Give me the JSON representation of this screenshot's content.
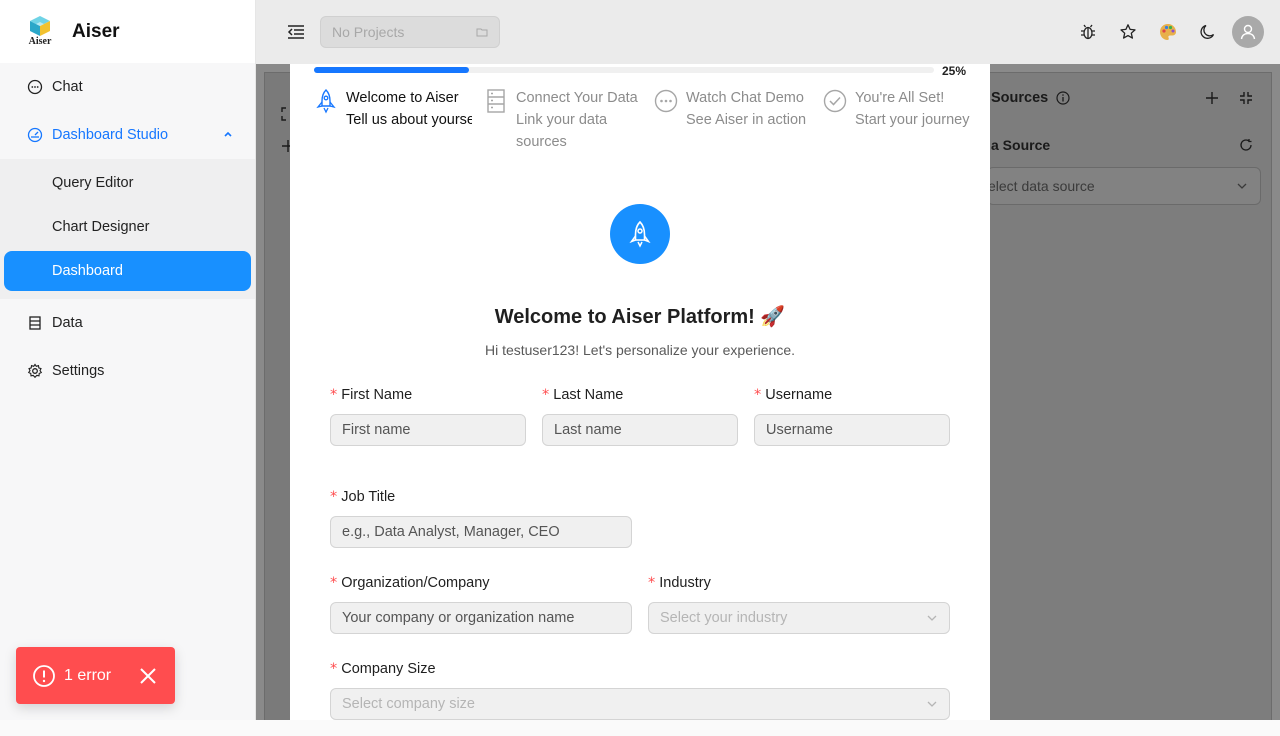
{
  "app": {
    "name": "Aiser",
    "logo_text": "Aiser"
  },
  "sidebar": {
    "items": [
      {
        "label": "Chat"
      },
      {
        "label": "Dashboard Studio"
      },
      {
        "label": "Data"
      },
      {
        "label": "Settings"
      }
    ],
    "sub_items": [
      {
        "label": "Query Editor"
      },
      {
        "label": "Chart Designer"
      },
      {
        "label": "Dashboard"
      }
    ]
  },
  "header": {
    "project_placeholder": "No Projects"
  },
  "workspace": {
    "sources_title": "Sources",
    "data_source_label": "a Source",
    "data_source_placeholder": "elect data source"
  },
  "onboarding": {
    "progress_percent": 25,
    "progress_label": "25%",
    "steps": [
      {
        "title": "Welcome to Aiser",
        "desc": "Tell us about yourself",
        "state": "current"
      },
      {
        "title": "Connect Your Data",
        "desc": "Link your data sources",
        "state": "todo"
      },
      {
        "title": "Watch Chat Demo",
        "desc": "See Aiser in action",
        "state": "todo"
      },
      {
        "title": "You're All Set!",
        "desc": "Start your journey",
        "state": "todo"
      }
    ],
    "title": "Welcome to Aiser Platform! 🚀",
    "subtitle": "Hi testuser123! Let's personalize your experience.",
    "fields": {
      "first_name": {
        "label": "First Name",
        "placeholder": "First name"
      },
      "last_name": {
        "label": "Last Name",
        "placeholder": "Last name"
      },
      "username": {
        "label": "Username",
        "placeholder": "Username"
      },
      "job_title": {
        "label": "Job Title",
        "placeholder": "e.g., Data Analyst, Manager, CEO"
      },
      "organization": {
        "label": "Organization/Company",
        "placeholder": "Your company or organization name"
      },
      "industry": {
        "label": "Industry",
        "placeholder": "Select your industry"
      },
      "company_size": {
        "label": "Company Size",
        "placeholder": "Select company size"
      }
    }
  },
  "toast": {
    "text": "1 error"
  },
  "colors": {
    "primary": "#1677ff",
    "selected_bg": "#1890ff",
    "error": "#ff4d4f"
  }
}
